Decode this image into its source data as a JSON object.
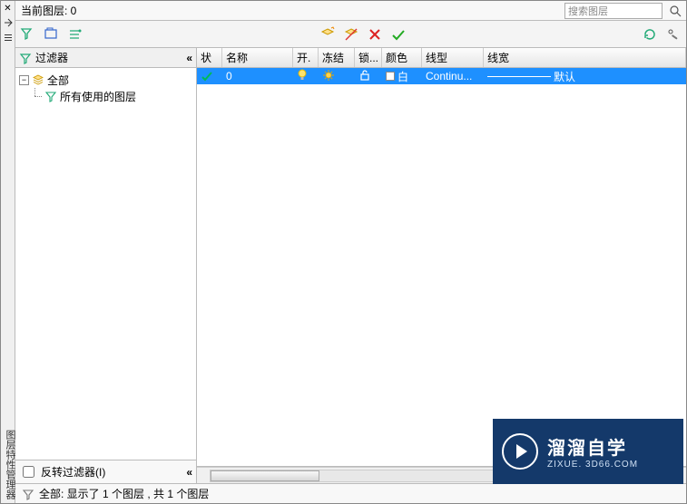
{
  "header": {
    "title": "当前图层: 0",
    "search_placeholder": "搜索图层"
  },
  "filter_panel": {
    "header": "过滤器",
    "tree": {
      "root": "全部",
      "child": "所有使用的图层"
    },
    "invert_label": "反转过滤器(I)"
  },
  "table": {
    "columns": {
      "state": "状",
      "name": "名称",
      "on": "开.",
      "freeze": "冻结",
      "lock": "锁...",
      "color": "颜色",
      "linetype": "线型",
      "lineweight": "线宽"
    },
    "rows": [
      {
        "name": "0",
        "color_label": "白",
        "linetype": "Continu...",
        "lineweight": "默认"
      }
    ]
  },
  "status": {
    "text": "全部: 显示了 1 个图层 , 共 1 个图层"
  },
  "side_label": "图层特性管理器",
  "watermark": {
    "main": "溜溜自学",
    "sub": "ZIXUE. 3D66.COM"
  }
}
